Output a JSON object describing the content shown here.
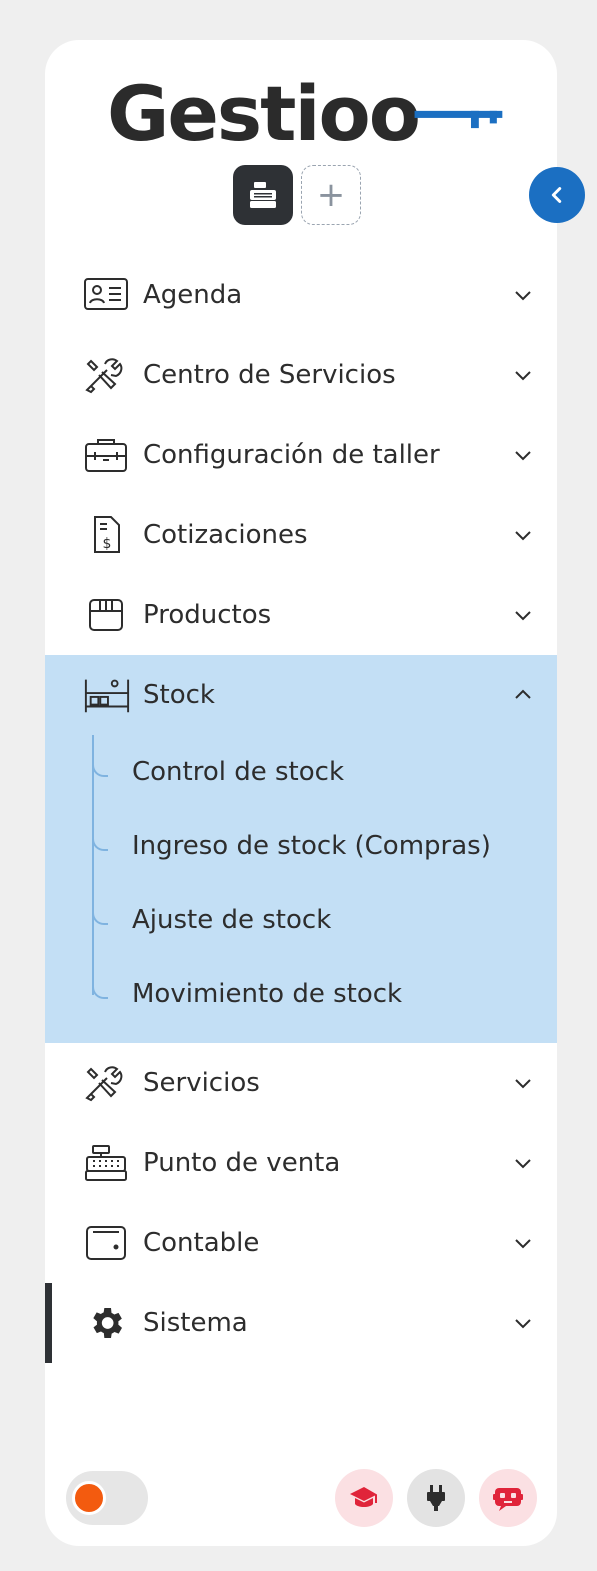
{
  "brand": {
    "name": "Gestioo"
  },
  "workspace": {
    "add_label": "+"
  },
  "menu": [
    {
      "label": "Agenda"
    },
    {
      "label": "Centro de Servicios"
    },
    {
      "label": "Configuración de taller"
    },
    {
      "label": "Cotizaciones"
    },
    {
      "label": "Productos"
    },
    {
      "label": "Stock",
      "expanded": true,
      "children": [
        {
          "label": "Control de stock"
        },
        {
          "label": "Ingreso de stock (Compras)"
        },
        {
          "label": "Ajuste de stock"
        },
        {
          "label": "Movimiento de stock"
        }
      ]
    },
    {
      "label": "Servicios"
    },
    {
      "label": "Punto de venta"
    },
    {
      "label": "Contable"
    },
    {
      "label": "Sistema",
      "active": true
    }
  ],
  "colors": {
    "accent": "#1b6fc2",
    "expanded_bg": "#c3dff5",
    "footer_icon_red": "#e0243a",
    "toggle_knob": "#f35b0f"
  },
  "icons": {
    "collapse": "chevron-left-icon",
    "footer": [
      "graduation-cap-icon",
      "plug-icon",
      "chat-robot-icon"
    ]
  }
}
